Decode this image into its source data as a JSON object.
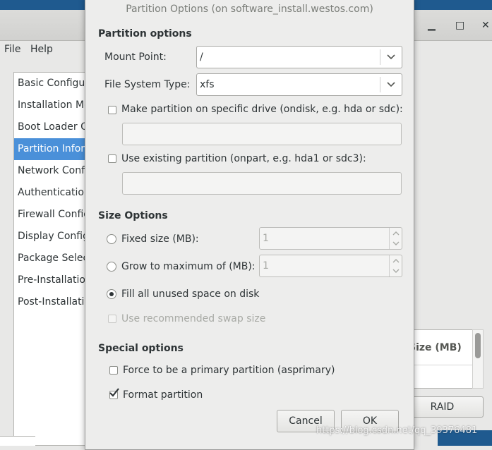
{
  "background_window": {
    "menu": [
      "File",
      "Help"
    ],
    "sidebar_items": [
      "Basic Configuration",
      "Installation Method",
      "Boot Loader Options",
      "Partition Information",
      "Network Configuration",
      "Authentication",
      "Firewall Configuration",
      "Display Configuration",
      "Package Selection",
      "Pre-Installation Script",
      "Post-Installation Script"
    ],
    "active_index": 3,
    "panel_header": "Size (MB)",
    "raid_label": "RAID"
  },
  "dialog": {
    "title": "Partition Options (on software_install.westos.com)",
    "partition_options": {
      "heading": "Partition options",
      "mount_point_label": "Mount Point:",
      "mount_point_value": "/",
      "fs_type_label": "File System Type:",
      "fs_type_value": "xfs",
      "ondisk_label": "Make partition on specific drive (ondisk, e.g. hda or sdc):",
      "onpart_label": "Use existing partition (onpart, e.g. hda1 or sdc3):"
    },
    "size_options": {
      "heading": "Size Options",
      "fixed_label": "Fixed size (MB):",
      "fixed_value": "1",
      "grow_label": "Grow to maximum of (MB):",
      "grow_value": "1",
      "fill_label": "Fill all unused space on disk",
      "swap_label": "Use recommended swap size"
    },
    "special_options": {
      "heading": "Special options",
      "primary_label": "Force to be a primary partition (asprimary)",
      "format_label": "Format partition"
    },
    "cancel_label": "Cancel",
    "ok_label": "OK"
  },
  "watermark": "https://blog.csdn.net/qq_39376481"
}
